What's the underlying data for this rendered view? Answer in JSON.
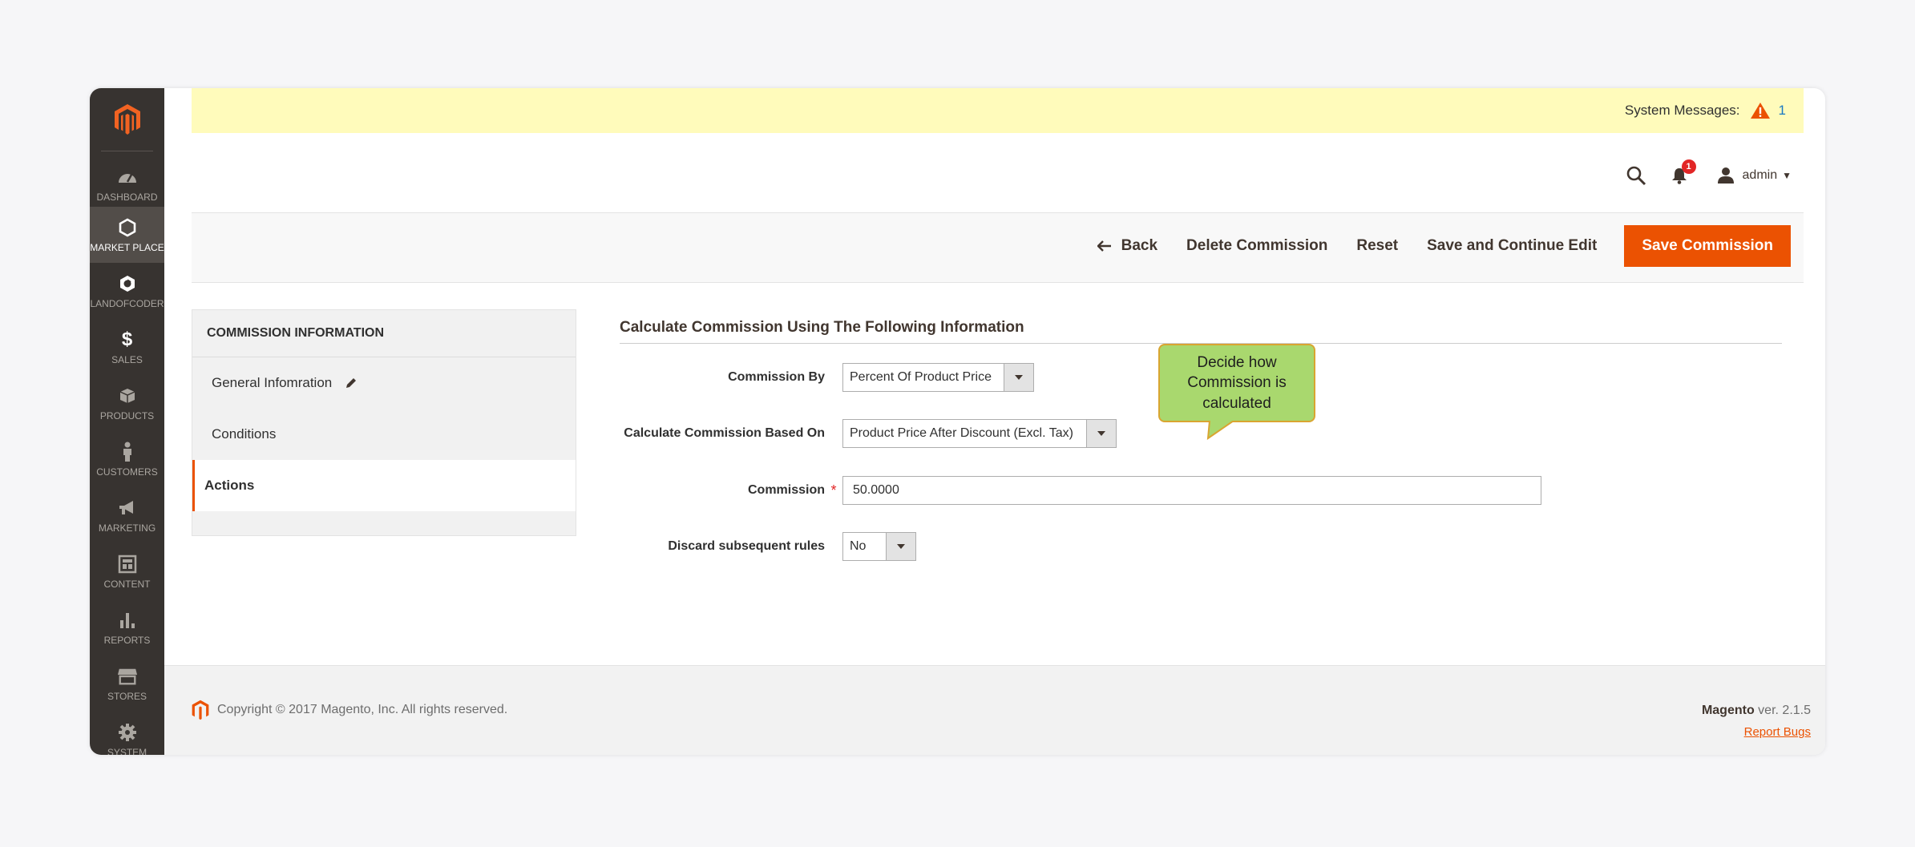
{
  "sidebar": {
    "items": [
      {
        "label": "DASHBOARD",
        "icon": "dashboard-icon"
      },
      {
        "label": "MARKET PLACE",
        "icon": "hexagon-icon"
      },
      {
        "label": "LANDOFCODER",
        "icon": "landofcoder-icon"
      },
      {
        "label": "SALES",
        "icon": "dollar-icon"
      },
      {
        "label": "PRODUCTS",
        "icon": "box-icon"
      },
      {
        "label": "CUSTOMERS",
        "icon": "person-icon"
      },
      {
        "label": "MARKETING",
        "icon": "megaphone-icon"
      },
      {
        "label": "CONTENT",
        "icon": "layout-icon"
      },
      {
        "label": "REPORTS",
        "icon": "bar-chart-icon"
      },
      {
        "label": "STORES",
        "icon": "storefront-icon"
      },
      {
        "label": "SYSTEM",
        "icon": "gear-icon"
      }
    ],
    "active": "MARKET PLACE"
  },
  "system_messages": {
    "label": "System Messages:",
    "count": "1"
  },
  "header": {
    "notification_count": "1",
    "user": "admin"
  },
  "actionbar": {
    "back": "Back",
    "delete": "Delete Commission",
    "reset": "Reset",
    "save_continue": "Save and Continue Edit",
    "save": "Save Commission"
  },
  "tabs": {
    "title": "COMMISSION INFORMATION",
    "items": [
      "General Infomration",
      "Conditions",
      "Actions"
    ],
    "active": "Actions"
  },
  "form": {
    "title": "Calculate Commission Using The Following Information",
    "commission_by": {
      "label": "Commission By",
      "value": "Percent Of Product Price"
    },
    "based_on": {
      "label": "Calculate Commission Based On",
      "value": "Product Price After Discount (Excl. Tax)"
    },
    "commission": {
      "label": "Commission",
      "value": "50.0000"
    },
    "discard": {
      "label": "Discard subsequent rules",
      "value": "No"
    }
  },
  "callout": {
    "text": "Decide how Commission is calculated"
  },
  "footer": {
    "copyright": "Copyright © 2017 Magento, Inc. All rights reserved.",
    "brand": "Magento",
    "version": " ver. 2.1.5",
    "report_bugs": "Report Bugs"
  },
  "colors": {
    "accent": "#eb5202",
    "sidebar": "#373330",
    "notice": "#fffbbb",
    "callout": "#a9d86e"
  }
}
